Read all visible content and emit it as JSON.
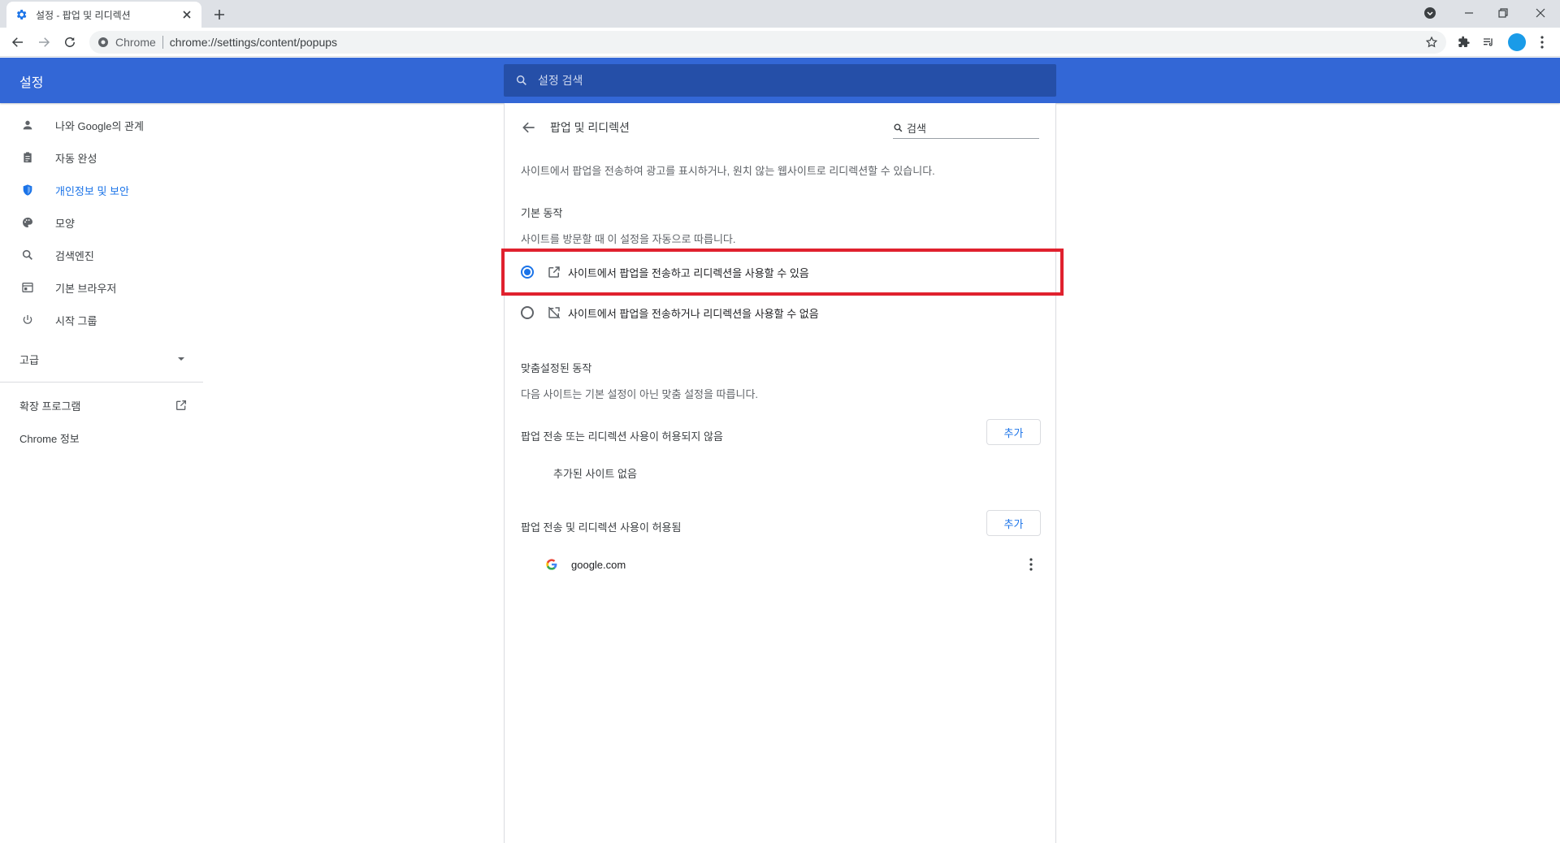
{
  "tab": {
    "title": "설정 - 팝업 및 리디렉션"
  },
  "omnibox": {
    "chip": "Chrome",
    "url": "chrome://settings/content/popups"
  },
  "header": {
    "title": "설정",
    "search_placeholder": "설정 검색"
  },
  "sidebar": {
    "items": [
      {
        "label": "나와 Google의 관계",
        "icon": "person-icon"
      },
      {
        "label": "자동 완성",
        "icon": "clipboard-icon"
      },
      {
        "label": "개인정보 및 보안",
        "icon": "shield-icon",
        "active": true
      },
      {
        "label": "모양",
        "icon": "palette-icon"
      },
      {
        "label": "검색엔진",
        "icon": "search-icon"
      },
      {
        "label": "기본 브라우저",
        "icon": "browser-icon"
      },
      {
        "label": "시작 그룹",
        "icon": "power-icon"
      }
    ],
    "advanced": "고급",
    "extensions": "확장 프로그램",
    "about": "Chrome 정보"
  },
  "main": {
    "title": "팝업 및 리디렉션",
    "search_placeholder": "검색",
    "description": "사이트에서 팝업을 전송하여 광고를 표시하거나, 원치 않는 웹사이트로 리디렉션할 수 있습니다.",
    "default_heading": "기본 동작",
    "default_sub": "사이트를 방문할 때 이 설정을 자동으로 따릅니다.",
    "option_allow": "사이트에서 팝업을 전송하고 리디렉션을 사용할 수 있음",
    "option_block": "사이트에서 팝업을 전송하거나 리디렉션을 사용할 수 없음",
    "custom_heading": "맞춤설정된 동작",
    "custom_sub": "다음 사이트는 기본 설정이 아닌 맞춤 설정을 따릅니다.",
    "blocked_heading": "팝업 전송 또는 리디렉션 사용이 허용되지 않음",
    "add_label": "추가",
    "no_sites": "추가된 사이트 없음",
    "allowed_heading": "팝업 전송 및 리디렉션 사용이 허용됨",
    "allowed_sites": [
      "google.com"
    ]
  },
  "colors": {
    "header": "#3367d6",
    "accent": "#1a73e8",
    "highlight": "#e0212e"
  }
}
